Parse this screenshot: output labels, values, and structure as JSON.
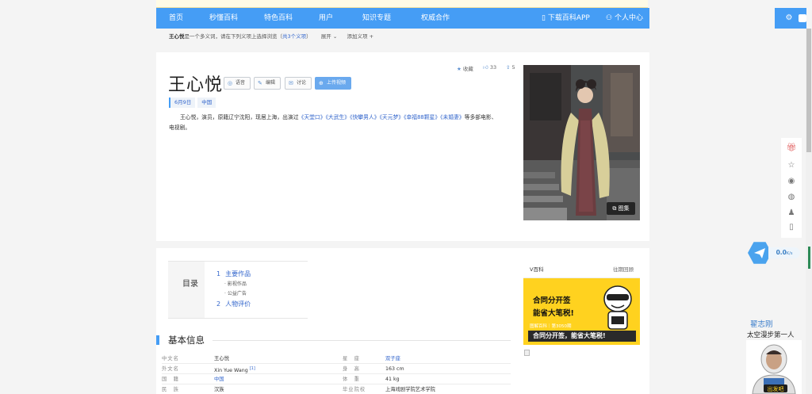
{
  "nav": {
    "items": [
      "首页",
      "秒懂百科",
      "特色百科",
      "用户",
      "知识专题",
      "权威合作"
    ],
    "download_app": "下载百科APP",
    "user_center": "个人中心"
  },
  "subbar": {
    "name": "王心悦",
    "text_mid": "是一个多义词，请在下列义项上选择浏览（",
    "count_link": "共3个义项",
    "text_end": "）",
    "expand": "展开",
    "add_meaning": "添加义项"
  },
  "entry": {
    "title": "王心悦",
    "buttons": [
      "语音",
      "编辑",
      "讨论",
      "上传视频"
    ],
    "stats": {
      "collect_label": "收藏",
      "likes": "33",
      "shares": "5"
    },
    "tags": [
      "6月9日",
      "中国"
    ],
    "summary": {
      "p1": "王心悦，演员，原籍辽宁沈阳，现居上海，出演过",
      "works": [
        "《天堂口》",
        "《大武生》",
        "《快攀男人》",
        "《天元梦》",
        "《幸福88颗星》",
        "《未婚妻》"
      ],
      "p2": "等多部电影、电视剧。"
    },
    "gallery_label": "图集"
  },
  "toc": {
    "title": "目录",
    "items": [
      {
        "num": "1",
        "label": "主要作品",
        "subs": [
          "影视作品",
          "公益广告"
        ]
      },
      {
        "num": "2",
        "label": "人物评价",
        "subs": []
      }
    ]
  },
  "basic_info": {
    "title": "基本信息",
    "rows": [
      {
        "l_label": "中文名",
        "l_val": "王心悦",
        "r_label": "星　座",
        "r_val": "双子座",
        "r_link": true
      },
      {
        "l_label": "外文名",
        "l_val": "Xin Yue Wang",
        "l_sup": "[1]",
        "r_label": "身　高",
        "r_val": "163 cm",
        "r_link": false
      },
      {
        "l_label": "国　籍",
        "l_val": "中国",
        "l_link": true,
        "r_label": "体　重",
        "r_val": "41 kg",
        "r_link": false
      },
      {
        "l_label": "民　族",
        "l_val": "汉族",
        "r_label": "毕业院校",
        "r_val": "上海戏剧学院艺术学院",
        "r_link": false
      }
    ]
  },
  "vbaike": {
    "title": "V百科",
    "more": "往期回顾",
    "ad_line1": "合同分开签",
    "ad_line2": "能省大笔税!",
    "ad_foot": "图解百科｜第3050期",
    "ad_strip": "合同分开签，能省大笔税!"
  },
  "speed": {
    "value": "0.0",
    "unit": "K/s"
  },
  "promo": {
    "name": "翟志刚",
    "subtitle": "太空漫步第一人",
    "badge": "出发吧"
  },
  "colors": {
    "accent": "#459df5",
    "link": "#3366cc",
    "ad_bg": "#ffd21f"
  }
}
